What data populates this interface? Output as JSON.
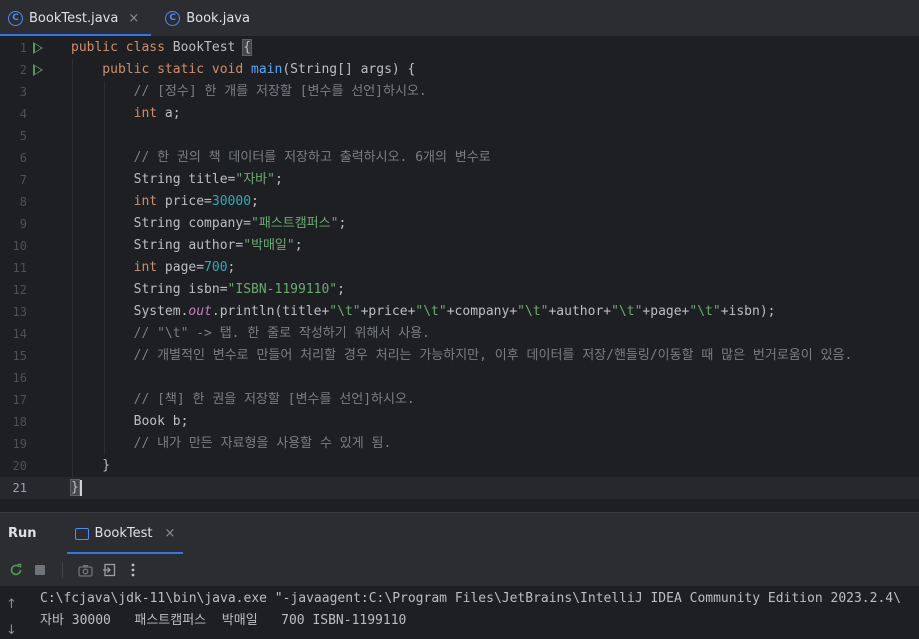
{
  "tabs": [
    {
      "label": "BookTest.java",
      "active": true,
      "icon": "class-icon"
    },
    {
      "label": "Book.java",
      "active": false,
      "icon": "class-icon"
    }
  ],
  "code_lines": [
    {
      "n": "1",
      "run": true,
      "tokens": [
        [
          "kw",
          "public class "
        ],
        [
          "plain",
          "BookTest "
        ],
        [
          "brace",
          "{"
        ]
      ]
    },
    {
      "n": "2",
      "run": true,
      "tokens": [
        [
          "kw",
          "    public static void "
        ],
        [
          "fn",
          "main"
        ],
        [
          "plain",
          "(String[] args) {"
        ]
      ]
    },
    {
      "n": "3",
      "tokens": [
        [
          "cm",
          "        // [정수] 한 개를 저장할 [변수를 선언]하시오."
        ]
      ]
    },
    {
      "n": "4",
      "tokens": [
        [
          "kw",
          "        int "
        ],
        [
          "plain",
          "a;"
        ]
      ]
    },
    {
      "n": "5",
      "tokens": []
    },
    {
      "n": "6",
      "tokens": [
        [
          "cm",
          "        // 한 권의 책 데이터를 저장하고 출력하시오. 6개의 변수로"
        ]
      ]
    },
    {
      "n": "7",
      "tokens": [
        [
          "plain",
          "        String title="
        ],
        [
          "str",
          "\"자바\""
        ],
        [
          "plain",
          ";"
        ]
      ]
    },
    {
      "n": "8",
      "tokens": [
        [
          "kw",
          "        int "
        ],
        [
          "plain",
          "price="
        ],
        [
          "num",
          "30000"
        ],
        [
          "plain",
          ";"
        ]
      ]
    },
    {
      "n": "9",
      "tokens": [
        [
          "plain",
          "        String company="
        ],
        [
          "str",
          "\"패스트캠퍼스\""
        ],
        [
          "plain",
          ";"
        ]
      ]
    },
    {
      "n": "10",
      "tokens": [
        [
          "plain",
          "        String author="
        ],
        [
          "str",
          "\"박매일\""
        ],
        [
          "plain",
          ";"
        ]
      ]
    },
    {
      "n": "11",
      "tokens": [
        [
          "kw",
          "        int "
        ],
        [
          "plain",
          "page="
        ],
        [
          "num",
          "700"
        ],
        [
          "plain",
          ";"
        ]
      ]
    },
    {
      "n": "12",
      "tokens": [
        [
          "plain",
          "        String isbn="
        ],
        [
          "str",
          "\"ISBN-1199110\""
        ],
        [
          "plain",
          ";"
        ]
      ]
    },
    {
      "n": "13",
      "tokens": [
        [
          "plain",
          "        System."
        ],
        [
          "st",
          "out"
        ],
        [
          "plain",
          ".println(title+"
        ],
        [
          "str",
          "\"\\t\""
        ],
        [
          "plain",
          "+price+"
        ],
        [
          "str",
          "\"\\t\""
        ],
        [
          "plain",
          "+company+"
        ],
        [
          "str",
          "\"\\t\""
        ],
        [
          "plain",
          "+author+"
        ],
        [
          "str",
          "\"\\t\""
        ],
        [
          "plain",
          "+page+"
        ],
        [
          "str",
          "\"\\t\""
        ],
        [
          "plain",
          "+isbn);"
        ]
      ]
    },
    {
      "n": "14",
      "tokens": [
        [
          "cm",
          "        // \"\\t\" -> 탭. 한 줄로 작성하기 위해서 사용."
        ]
      ]
    },
    {
      "n": "15",
      "tokens": [
        [
          "cm",
          "        // 개별적인 변수로 만들어 처리할 경우 처리는 가능하지만, 이후 데이터를 저장/핸들링/이동할 때 많은 번거로움이 있음."
        ]
      ]
    },
    {
      "n": "16",
      "tokens": []
    },
    {
      "n": "17",
      "tokens": [
        [
          "cm",
          "        // [책] 한 권을 저장할 [변수를 선언]하시오."
        ]
      ]
    },
    {
      "n": "18",
      "tokens": [
        [
          "plain",
          "        Book b;"
        ]
      ]
    },
    {
      "n": "19",
      "tokens": [
        [
          "cm",
          "        // 내가 만든 자료형을 사용할 수 있게 됨."
        ]
      ]
    },
    {
      "n": "20",
      "tokens": [
        [
          "plain",
          "    }"
        ]
      ]
    },
    {
      "n": "21",
      "current": true,
      "tokens": [
        [
          "brace",
          "}"
        ]
      ]
    }
  ],
  "run_panel": {
    "title": "Run",
    "tab_label": "BookTest",
    "close_glyph": "×"
  },
  "toolbar_icons": [
    "rerun-icon",
    "stop-icon",
    "camera-icon",
    "exit-icon",
    "more-icon"
  ],
  "console": {
    "lines": [
      "C:\\fcjava\\jdk-11\\bin\\java.exe \"-javaagent:C:\\Program Files\\JetBrains\\IntelliJ IDEA Community Edition 2023.2.4\\",
      "자바 30000   패스트캠퍼스  박매일   700 ISBN-1199110"
    ]
  },
  "colors": {
    "accent": "#3574f0",
    "keyword": "#cf8e6d",
    "string": "#6aab73",
    "number": "#2aacb8",
    "comment": "#7a7e85",
    "method": "#56a8f5",
    "static_field": "#c77dbb"
  }
}
